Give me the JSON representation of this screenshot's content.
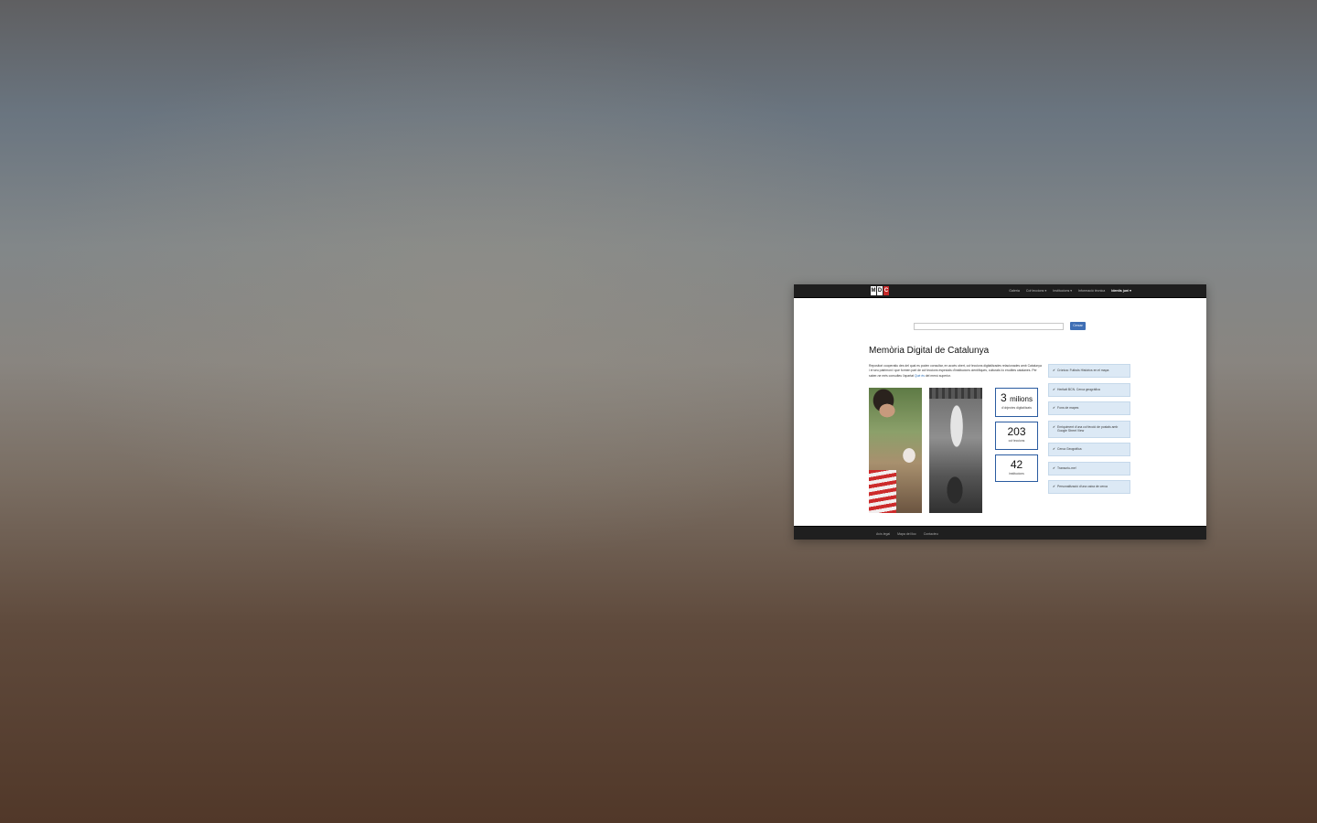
{
  "navbar": {
    "logo_letters": [
      "M",
      "D",
      "C"
    ],
    "items": [
      "Galeria",
      "Col·leccions ▾",
      "Institucions ▾",
      "Informació tècnica",
      "Identis juni ▾"
    ]
  },
  "search": {
    "placeholder": "",
    "button_label": "Cercar"
  },
  "title": "Memòria Digital de Catalunya",
  "intro": {
    "text": "Repositori cooperatiu des del qual es poden consultar, en accés obert, col·leccions digitalitzades relacionades amb Catalunya i el seu patrimoni i que formen part de col·leccions especials d'institucions científiques, culturals i/o erudites catalanes. Per saber-ne més consulteu l'apartat ",
    "link": "Què és",
    "suffix": " del menú superior."
  },
  "stats": [
    {
      "number": "3",
      "unit": "milions",
      "label": "d'objectes digitalitzats"
    },
    {
      "number": "203",
      "unit": "",
      "label": "col·leccions"
    },
    {
      "number": "42",
      "unit": "",
      "label": "institucions"
    }
  ],
  "features": [
    "Crònica: Futbols Històrics en el mapa",
    "Heritatt BCN. Cerca geogràfica",
    "Fons de mapes",
    "Enriquiment d'una col·lecció de postals amb Google Street View",
    "Cerca Geogràfica",
    "Transcriu-me!",
    "Personalització d'una caixa de cerca"
  ],
  "footer": {
    "links": [
      "Avís legal",
      "Mapa del lloc",
      "Contacteu"
    ]
  }
}
